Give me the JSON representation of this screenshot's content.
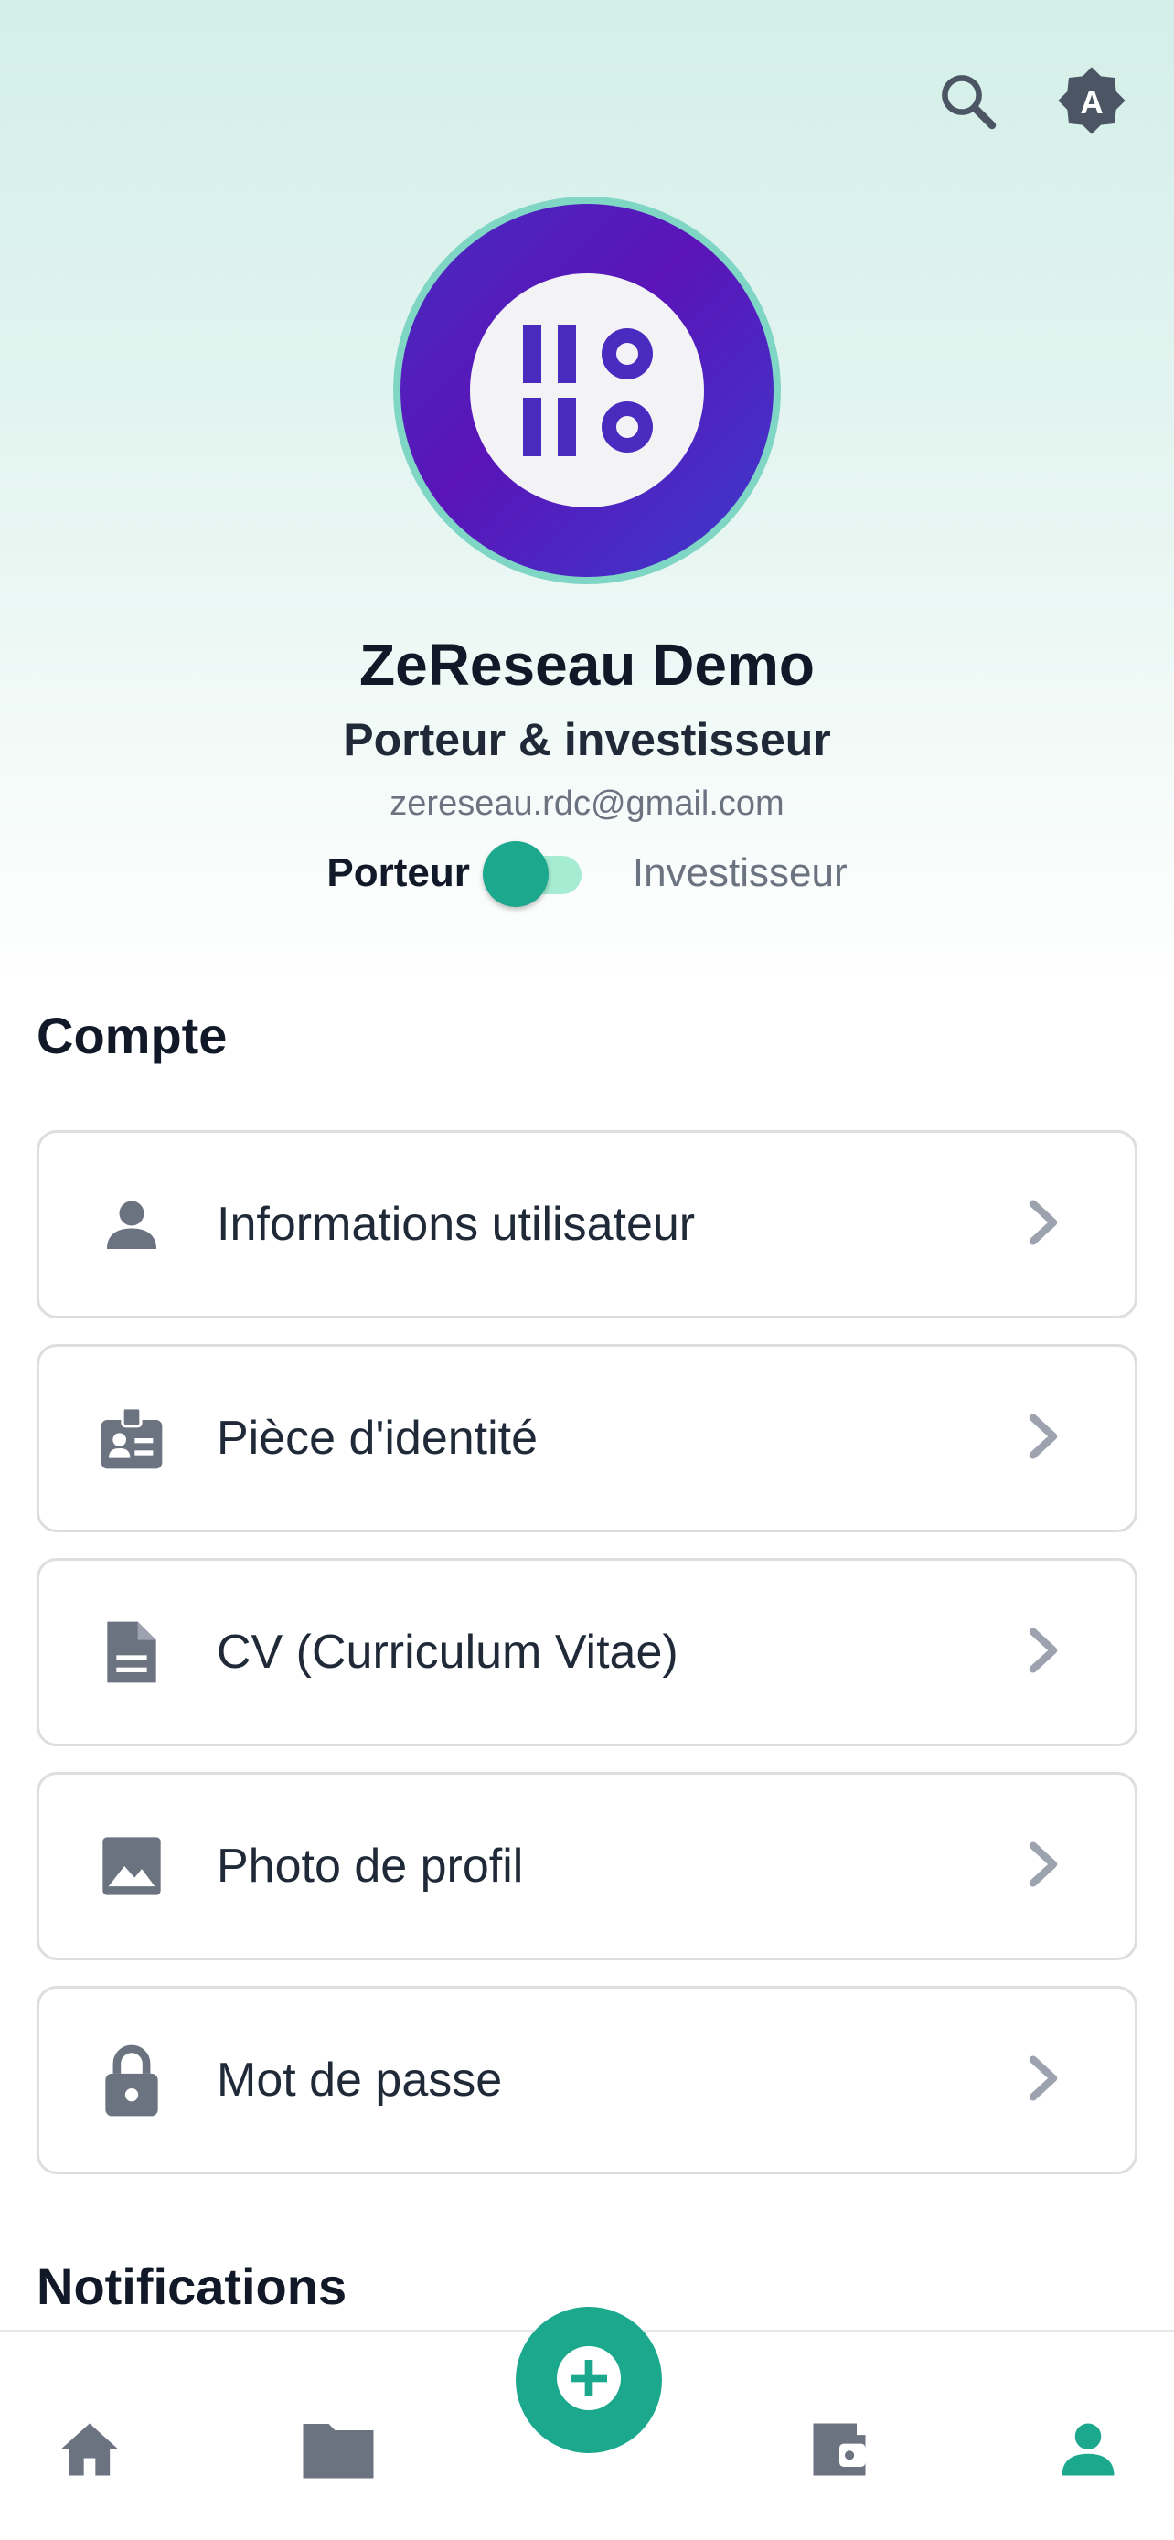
{
  "header": {
    "icons": [
      "search-icon",
      "auto-brightness-icon"
    ]
  },
  "profile": {
    "name": "ZeReseau Demo",
    "role": "Porteur & investisseur",
    "email": "zereseau.rdc@gmail.com",
    "toggle": {
      "left_label": "Porteur",
      "right_label": "Investisseur",
      "active": "Porteur"
    }
  },
  "sections": {
    "account_title": "Compte",
    "notifications_title": "Notifications"
  },
  "account_items": [
    {
      "label": "Informations utilisateur",
      "icon": "person-icon"
    },
    {
      "label": "Pièce d'identité",
      "icon": "id-badge-icon"
    },
    {
      "label": "CV (Curriculum Vitae)",
      "icon": "document-icon"
    },
    {
      "label": "Photo de profil",
      "icon": "image-icon"
    },
    {
      "label": "Mot de passe",
      "icon": "lock-icon"
    }
  ],
  "bottom_nav": [
    {
      "name": "home",
      "icon": "home-icon"
    },
    {
      "name": "folder",
      "icon": "folder-icon"
    },
    {
      "name": "add",
      "icon": "plus-icon"
    },
    {
      "name": "wallet",
      "icon": "wallet-icon"
    },
    {
      "name": "profile",
      "icon": "person-icon",
      "active": true
    }
  ],
  "colors": {
    "accent": "#1ba88d",
    "logo_purple": "#4a2bc0",
    "icon_gray": "#6b7280",
    "hero_bg": "#d3efe8"
  }
}
